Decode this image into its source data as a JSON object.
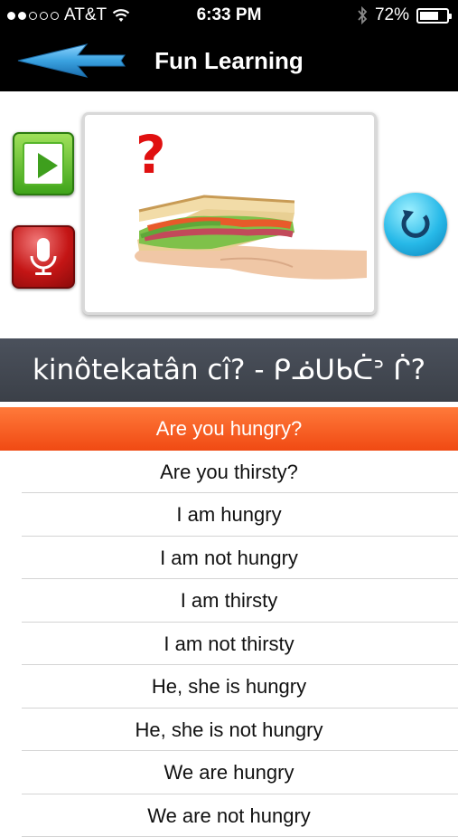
{
  "status_bar": {
    "carrier": "AT&T",
    "time": "6:33 PM",
    "battery": "72%",
    "battery_level": 0.72,
    "signal_bars": 2,
    "icons": [
      "signal-dots-icon",
      "wifi-icon",
      "bluetooth-icon",
      "battery-icon"
    ]
  },
  "nav": {
    "title": "Fun Learning",
    "back_icon": "back-arrow-icon"
  },
  "controls": {
    "play_icon": "play-icon",
    "record_icon": "microphone-icon",
    "replay_icon": "replay-icon"
  },
  "card": {
    "image": "sandwich-in-hand",
    "question_mark": "?"
  },
  "phrase": "kinôtekatân cî? - ᑭᓅᑌᑲᑖᐣ ᒌ?",
  "list": {
    "selected_index": 0,
    "items": [
      "Are you hungry?",
      "Are you thirsty?",
      "I am hungry",
      "I am not hungry",
      "I am thirsty",
      "I am not thirsty",
      "He, she is hungry",
      "He, she is not hungry",
      "We are hungry",
      "We are not hungry"
    ]
  },
  "colors": {
    "selected_row": "#f25a1f",
    "phrase_bar": "#434852",
    "play_green": "#4cb322",
    "record_red": "#c41515",
    "replay_blue": "#27b9e8",
    "back_arrow": "#3aa2e0"
  }
}
